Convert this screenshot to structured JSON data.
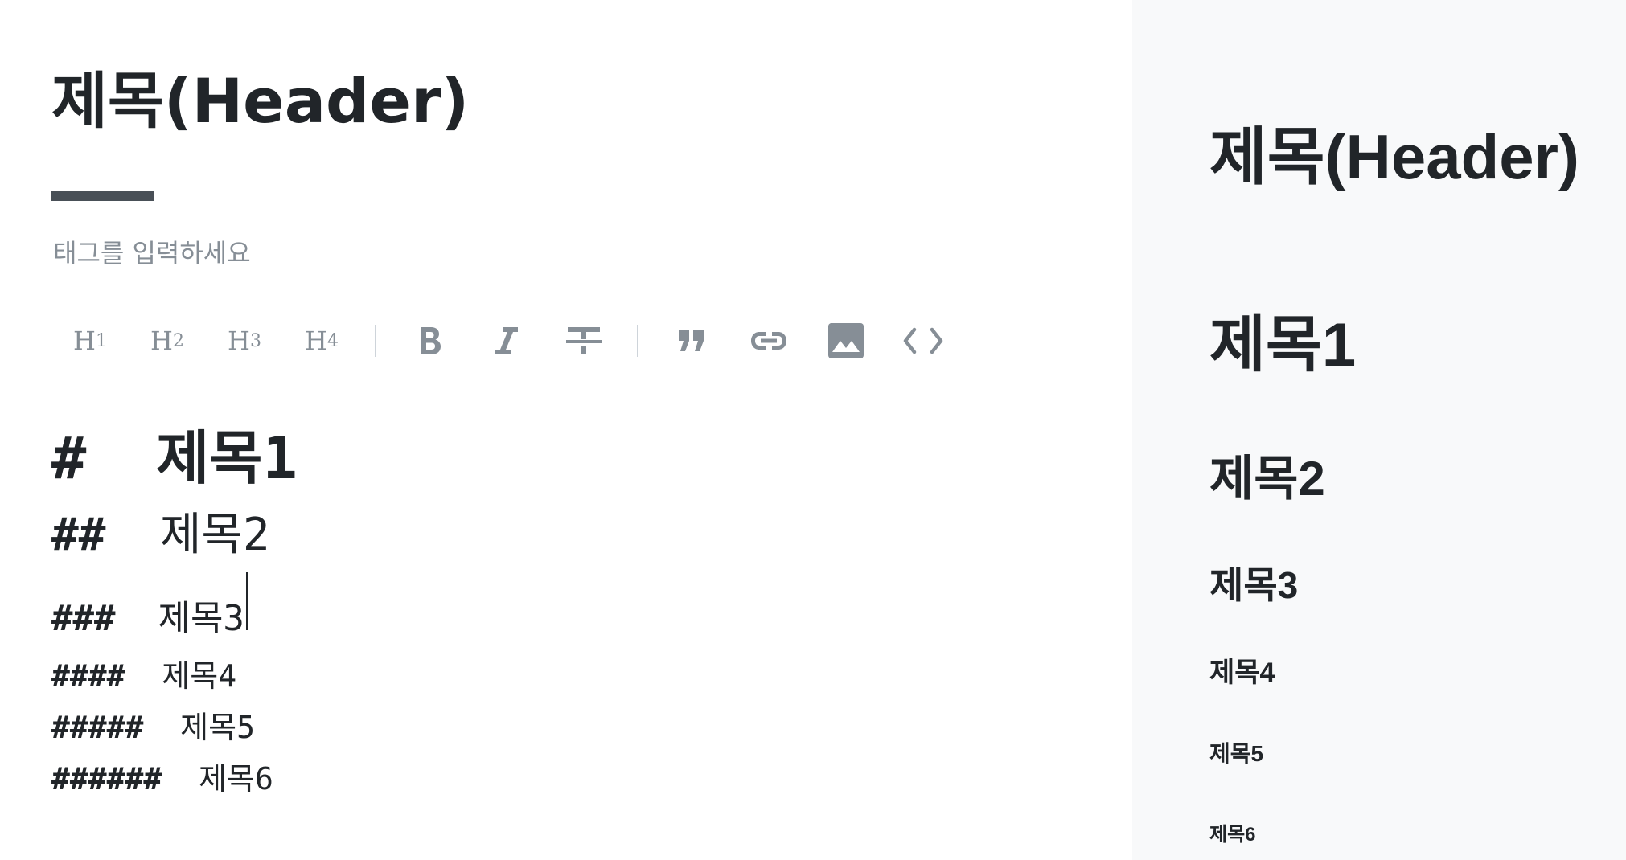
{
  "editor": {
    "title": "제목(Header)",
    "tag_placeholder": "태그를 입력하세요",
    "toolbar": {
      "h1": "H",
      "h1_sub": "1",
      "h2": "H",
      "h2_sub": "2",
      "h3": "H",
      "h3_sub": "3",
      "h4": "H",
      "h4_sub": "4",
      "icons": [
        "bold-icon",
        "italic-icon",
        "strikethrough-icon",
        "quote-icon",
        "link-icon",
        "image-icon",
        "code-icon"
      ]
    },
    "lines": [
      {
        "marker": "#",
        "text": "제목1"
      },
      {
        "marker": "##",
        "text": "제목2"
      },
      {
        "marker": "###",
        "text": "제목3"
      },
      {
        "marker": "####",
        "text": "제목4"
      },
      {
        "marker": "#####",
        "text": "제목5"
      },
      {
        "marker": "######",
        "text": "제목6"
      }
    ]
  },
  "preview": {
    "title": "제목(Header)",
    "h1": "제목1",
    "h2": "제목2",
    "h3": "제목3",
    "h4": "제목4",
    "h5": "제목5",
    "h6": "제목6"
  },
  "colors": {
    "text": "#212529",
    "muted": "#868e96",
    "divider": "#495057",
    "preview_bg": "#f8f9fa"
  }
}
